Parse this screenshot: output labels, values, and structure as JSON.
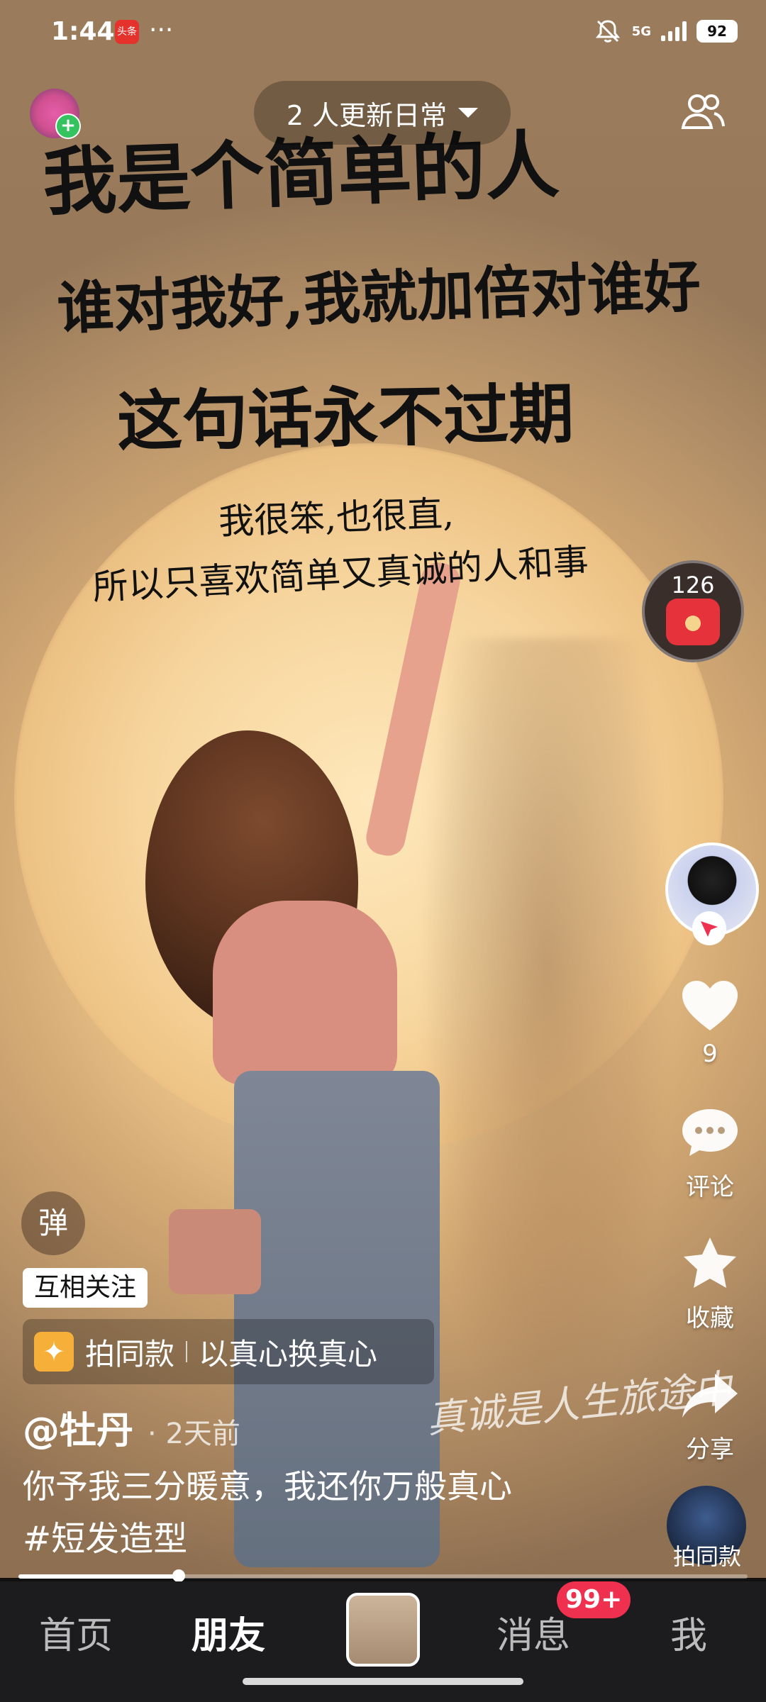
{
  "status_bar": {
    "time": "1:44",
    "news_app_badge": "头条",
    "more_dots": "···",
    "network": "5G",
    "battery": "92"
  },
  "top": {
    "updates_pill": "2 人更新日常"
  },
  "video_text": {
    "line1": "我是个简单的人",
    "line2": "谁对我好,我就加倍对谁好",
    "line3": "这句话永不过期",
    "line4": "我很笨,也很直,",
    "line5": "所以只喜欢简单又真诚的人和事",
    "cursive": "真诚是人生旅途中"
  },
  "right_column": {
    "red_packet_count": "126",
    "like_count": "9",
    "comment_label": "评论",
    "favorite_label": "收藏",
    "share_label": "分享",
    "same_style_label": "拍同款"
  },
  "overlays": {
    "danmu_button": "弹",
    "mutual_follow": "互相关注",
    "same_style_prefix": "拍同款",
    "same_style_text": "以真心换真心",
    "author": "@牡丹",
    "posted_ago": "· 2天前",
    "caption": "你予我三分暖意，我还你万般真心",
    "hashtag": "#短发造型"
  },
  "progress": {
    "fraction": 0.22
  },
  "bottom_nav": {
    "home": "首页",
    "friends": "朋友",
    "messages": "消息",
    "messages_badge": "99+",
    "me": "我"
  },
  "colors": {
    "badge_red": "#f0304f",
    "follow_green": "#35c35f",
    "nav_bg": "#1c1c1f"
  }
}
